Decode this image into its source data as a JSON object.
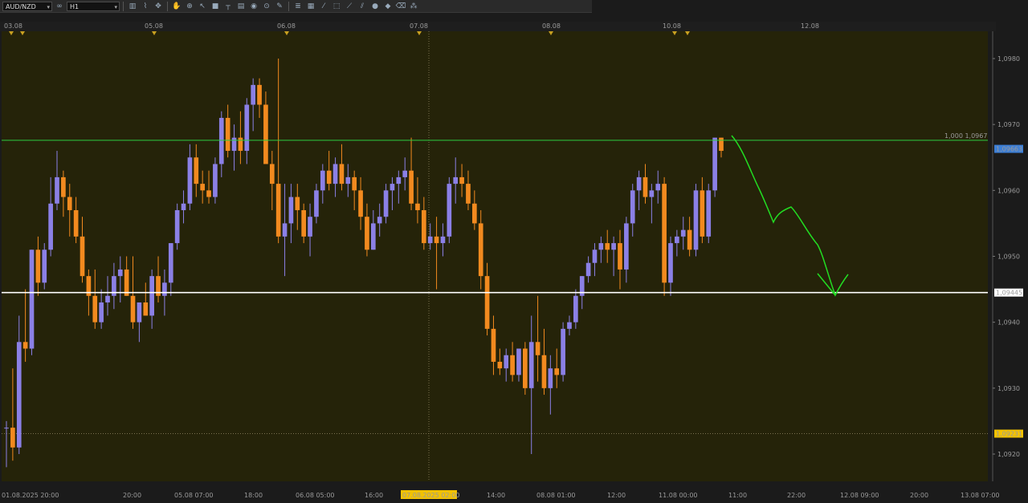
{
  "toolbar": {
    "symbol": "AUD/NZD",
    "timeframe": "H1",
    "tools": [
      "candles-icon",
      "indicator-icon",
      "crosshair-icon",
      "cursor-icon",
      "line-icon",
      "hline-icon",
      "text-icon",
      "camera-icon",
      "globe-icon",
      "pencil-icon",
      "objects-icon",
      "grid-icon",
      "fib-icon",
      "shapes-icon",
      "circle-icon",
      "eraser-icon",
      "settings-icon"
    ]
  },
  "colors": {
    "background": "#252309",
    "bull": "#8b80e6",
    "bear": "#f28a1f",
    "green_level": "#2ecc40",
    "white_level": "#ffffff",
    "drawing": "#22dd22",
    "last_price_tag": "#3d7fd6",
    "crosshair_tag": "#f2c200"
  },
  "top_dates": [
    "03.08",
    "05.08",
    "06.08",
    "07.08",
    "08.08",
    "10.08",
    "12.08"
  ],
  "chart_data": {
    "type": "candlestick",
    "symbol": "AUD/NZD",
    "timeframe": "H1",
    "ylim": [
      1.0915,
      1.0985
    ],
    "y_ticks": [
      "1,0980",
      "1,0970",
      "1,0960",
      "1,0950",
      "1,0940",
      "1,0930",
      "1,0920"
    ],
    "x_tick_labels": [
      "01.08.2025 20:00",
      "20:00",
      "05.08 07:00",
      "18:00",
      "06.08 05:00",
      "16:00",
      "07.08.2025 02:00",
      "14:00",
      "08.08 01:00",
      "12:00",
      "11.08 00:00",
      "11:00",
      "22:00",
      "12.08 09:00",
      "20:00",
      "13.08 07:00"
    ],
    "levels": [
      {
        "name": "level-1000",
        "price": 1.09676,
        "label": "1,000 1,09676"
      },
      {
        "name": "support",
        "price": 1.09445,
        "label": "1,09445"
      }
    ],
    "last_price": "1,09663",
    "crosshair_price": "1,09231",
    "crosshair_time": "07.08.2025 02:00",
    "candles": [
      [
        1.0924,
        1.0925,
        1.0918,
        1.0924
      ],
      [
        1.0924,
        1.0933,
        1.0919,
        1.0921
      ],
      [
        1.0921,
        1.0941,
        1.092,
        1.0937
      ],
      [
        1.0937,
        1.0945,
        1.0934,
        1.0936
      ],
      [
        1.0936,
        1.0951,
        1.0935,
        1.0951
      ],
      [
        1.0951,
        1.0953,
        1.0944,
        1.0946
      ],
      [
        1.0946,
        1.0952,
        1.0945,
        1.0951
      ],
      [
        1.0951,
        1.0962,
        1.095,
        1.0958
      ],
      [
        1.0958,
        1.0966,
        1.0957,
        1.0962
      ],
      [
        1.0962,
        1.0963,
        1.0956,
        1.0959
      ],
      [
        1.0959,
        1.0961,
        1.0953,
        1.0957
      ],
      [
        1.0957,
        1.0959,
        1.0952,
        1.0953
      ],
      [
        1.0953,
        1.0956,
        1.0946,
        1.0947
      ],
      [
        1.0947,
        1.0948,
        1.0941,
        1.0944
      ],
      [
        1.0944,
        1.0948,
        1.0939,
        1.094
      ],
      [
        1.094,
        1.0945,
        1.0939,
        1.0943
      ],
      [
        1.0943,
        1.0947,
        1.0941,
        1.0944
      ],
      [
        1.0944,
        1.0949,
        1.0942,
        1.0947
      ],
      [
        1.0947,
        1.095,
        1.0943,
        1.0948
      ],
      [
        1.0948,
        1.095,
        1.0944,
        1.0944
      ],
      [
        1.0944,
        1.095,
        1.0939,
        1.094
      ],
      [
        1.094,
        1.0943,
        1.0937,
        1.0943
      ],
      [
        1.0943,
        1.0946,
        1.0941,
        1.0941
      ],
      [
        1.0941,
        1.0948,
        1.0939,
        1.0947
      ],
      [
        1.0947,
        1.095,
        1.0943,
        1.0944
      ],
      [
        1.0944,
        1.0948,
        1.0941,
        1.0946
      ],
      [
        1.0946,
        1.0952,
        1.0944,
        1.0952
      ],
      [
        1.0952,
        1.0958,
        1.0951,
        1.0957
      ],
      [
        1.0957,
        1.096,
        1.0955,
        1.0958
      ],
      [
        1.0958,
        1.0967,
        1.0957,
        1.0965
      ],
      [
        1.0965,
        1.0967,
        1.0959,
        1.0961
      ],
      [
        1.0961,
        1.0963,
        1.0958,
        1.096
      ],
      [
        1.096,
        1.0963,
        1.0958,
        1.0959
      ],
      [
        1.0959,
        1.0965,
        1.0958,
        1.0964
      ],
      [
        1.0964,
        1.0972,
        1.0962,
        1.0971
      ],
      [
        1.0971,
        1.0973,
        1.0965,
        1.0966
      ],
      [
        1.0966,
        1.097,
        1.0963,
        1.0968
      ],
      [
        1.0968,
        1.0972,
        1.0964,
        1.0966
      ],
      [
        1.0966,
        1.0974,
        1.0964,
        1.0973
      ],
      [
        1.0973,
        1.0977,
        1.0969,
        1.0976
      ],
      [
        1.0976,
        1.0977,
        1.0971,
        1.0973
      ],
      [
        1.0973,
        1.0975,
        1.0965,
        1.0964
      ],
      [
        1.0964,
        1.0966,
        1.0957,
        1.0961
      ],
      [
        1.0961,
        1.098,
        1.0952,
        1.0953
      ],
      [
        1.0953,
        1.0961,
        1.0947,
        1.0955
      ],
      [
        1.0955,
        1.0961,
        1.0952,
        1.0959
      ],
      [
        1.0959,
        1.0961,
        1.0954,
        1.0957
      ],
      [
        1.0957,
        1.0958,
        1.0952,
        1.0953
      ],
      [
        1.0953,
        1.0958,
        1.095,
        1.0956
      ],
      [
        1.0956,
        1.0961,
        1.0955,
        1.096
      ],
      [
        1.096,
        1.0964,
        1.0958,
        1.0963
      ],
      [
        1.0963,
        1.0966,
        1.096,
        1.0961
      ],
      [
        1.0961,
        1.0965,
        1.0959,
        1.0964
      ],
      [
        1.0964,
        1.0967,
        1.096,
        1.0961
      ],
      [
        1.0961,
        1.0964,
        1.0959,
        1.0962
      ],
      [
        1.0962,
        1.0963,
        1.0957,
        1.096
      ],
      [
        1.096,
        1.0962,
        1.0954,
        1.0956
      ],
      [
        1.0956,
        1.0958,
        1.095,
        1.0951
      ],
      [
        1.0951,
        1.0957,
        1.0951,
        1.0955
      ],
      [
        1.0955,
        1.0958,
        1.0953,
        1.0956
      ],
      [
        1.0956,
        1.0961,
        1.0955,
        1.096
      ],
      [
        1.096,
        1.0962,
        1.0957,
        1.0961
      ],
      [
        1.0961,
        1.0963,
        1.0958,
        1.0962
      ],
      [
        1.0962,
        1.0965,
        1.096,
        1.0963
      ],
      [
        1.0963,
        1.0968,
        1.0957,
        1.0958
      ],
      [
        1.0958,
        1.0962,
        1.0955,
        1.0957
      ],
      [
        1.0957,
        1.0959,
        1.0951,
        1.0952
      ],
      [
        1.0952,
        1.0955,
        1.0951,
        1.0953
      ],
      [
        1.0953,
        1.0956,
        1.0945,
        1.0952
      ],
      [
        1.0952,
        1.0955,
        1.095,
        1.0953
      ],
      [
        1.0953,
        1.0962,
        1.0952,
        1.0961
      ],
      [
        1.0961,
        1.0965,
        1.0958,
        1.0962
      ],
      [
        1.0962,
        1.0964,
        1.0959,
        1.0961
      ],
      [
        1.0961,
        1.0963,
        1.0957,
        1.0958
      ],
      [
        1.0958,
        1.096,
        1.0954,
        1.0955
      ],
      [
        1.0955,
        1.0957,
        1.0945,
        1.0947
      ],
      [
        1.0947,
        1.0949,
        1.0938,
        1.0939
      ],
      [
        1.0939,
        1.0941,
        1.0932,
        1.0934
      ],
      [
        1.0934,
        1.0936,
        1.0932,
        1.0933
      ],
      [
        1.0933,
        1.0936,
        1.0931,
        1.0935
      ],
      [
        1.0935,
        1.0937,
        1.0931,
        1.0932
      ],
      [
        1.0932,
        1.0936,
        1.0931,
        1.0936
      ],
      [
        1.0936,
        1.0937,
        1.0929,
        1.093
      ],
      [
        1.093,
        1.0941,
        1.092,
        1.0937
      ],
      [
        1.0937,
        1.0944,
        1.0931,
        1.0935
      ],
      [
        1.0935,
        1.0939,
        1.0929,
        1.093
      ],
      [
        1.093,
        1.0935,
        1.0926,
        1.0933
      ],
      [
        1.0933,
        1.0936,
        1.093,
        1.0932
      ],
      [
        1.0932,
        1.094,
        1.0931,
        1.0939
      ],
      [
        1.0939,
        1.0941,
        1.0938,
        1.094
      ],
      [
        1.094,
        1.0945,
        1.0939,
        1.0944
      ],
      [
        1.0944,
        1.0947,
        1.0942,
        1.0947
      ],
      [
        1.0947,
        1.095,
        1.0946,
        1.0949
      ],
      [
        1.0949,
        1.0952,
        1.0947,
        1.0951
      ],
      [
        1.0951,
        1.0953,
        1.0949,
        1.0952
      ],
      [
        1.0952,
        1.0954,
        1.0949,
        1.0951
      ],
      [
        1.0951,
        1.0953,
        1.0947,
        1.0952
      ],
      [
        1.0952,
        1.0954,
        1.0945,
        1.0948
      ],
      [
        1.0948,
        1.0956,
        1.0946,
        1.0955
      ],
      [
        1.0955,
        1.0961,
        1.0953,
        1.096
      ],
      [
        1.096,
        1.0963,
        1.0957,
        1.0962
      ],
      [
        1.0962,
        1.0964,
        1.0958,
        1.0959
      ],
      [
        1.0959,
        1.0961,
        1.0955,
        1.096
      ],
      [
        1.096,
        1.0963,
        1.0958,
        1.0961
      ],
      [
        1.0961,
        1.0962,
        1.0944,
        1.0946
      ],
      [
        1.0946,
        1.0953,
        1.0944,
        1.0952
      ],
      [
        1.0952,
        1.0954,
        1.095,
        1.0953
      ],
      [
        1.0953,
        1.0956,
        1.0951,
        1.0954
      ],
      [
        1.0954,
        1.0956,
        1.095,
        1.0951
      ],
      [
        1.0951,
        1.0961,
        1.095,
        1.096
      ],
      [
        1.096,
        1.0962,
        1.0952,
        1.0953
      ],
      [
        1.0953,
        1.0961,
        1.0952,
        1.096
      ],
      [
        1.096,
        1.0968,
        1.0959,
        1.0968
      ],
      [
        1.0968,
        1.0968,
        1.0965,
        1.0966
      ]
    ]
  }
}
